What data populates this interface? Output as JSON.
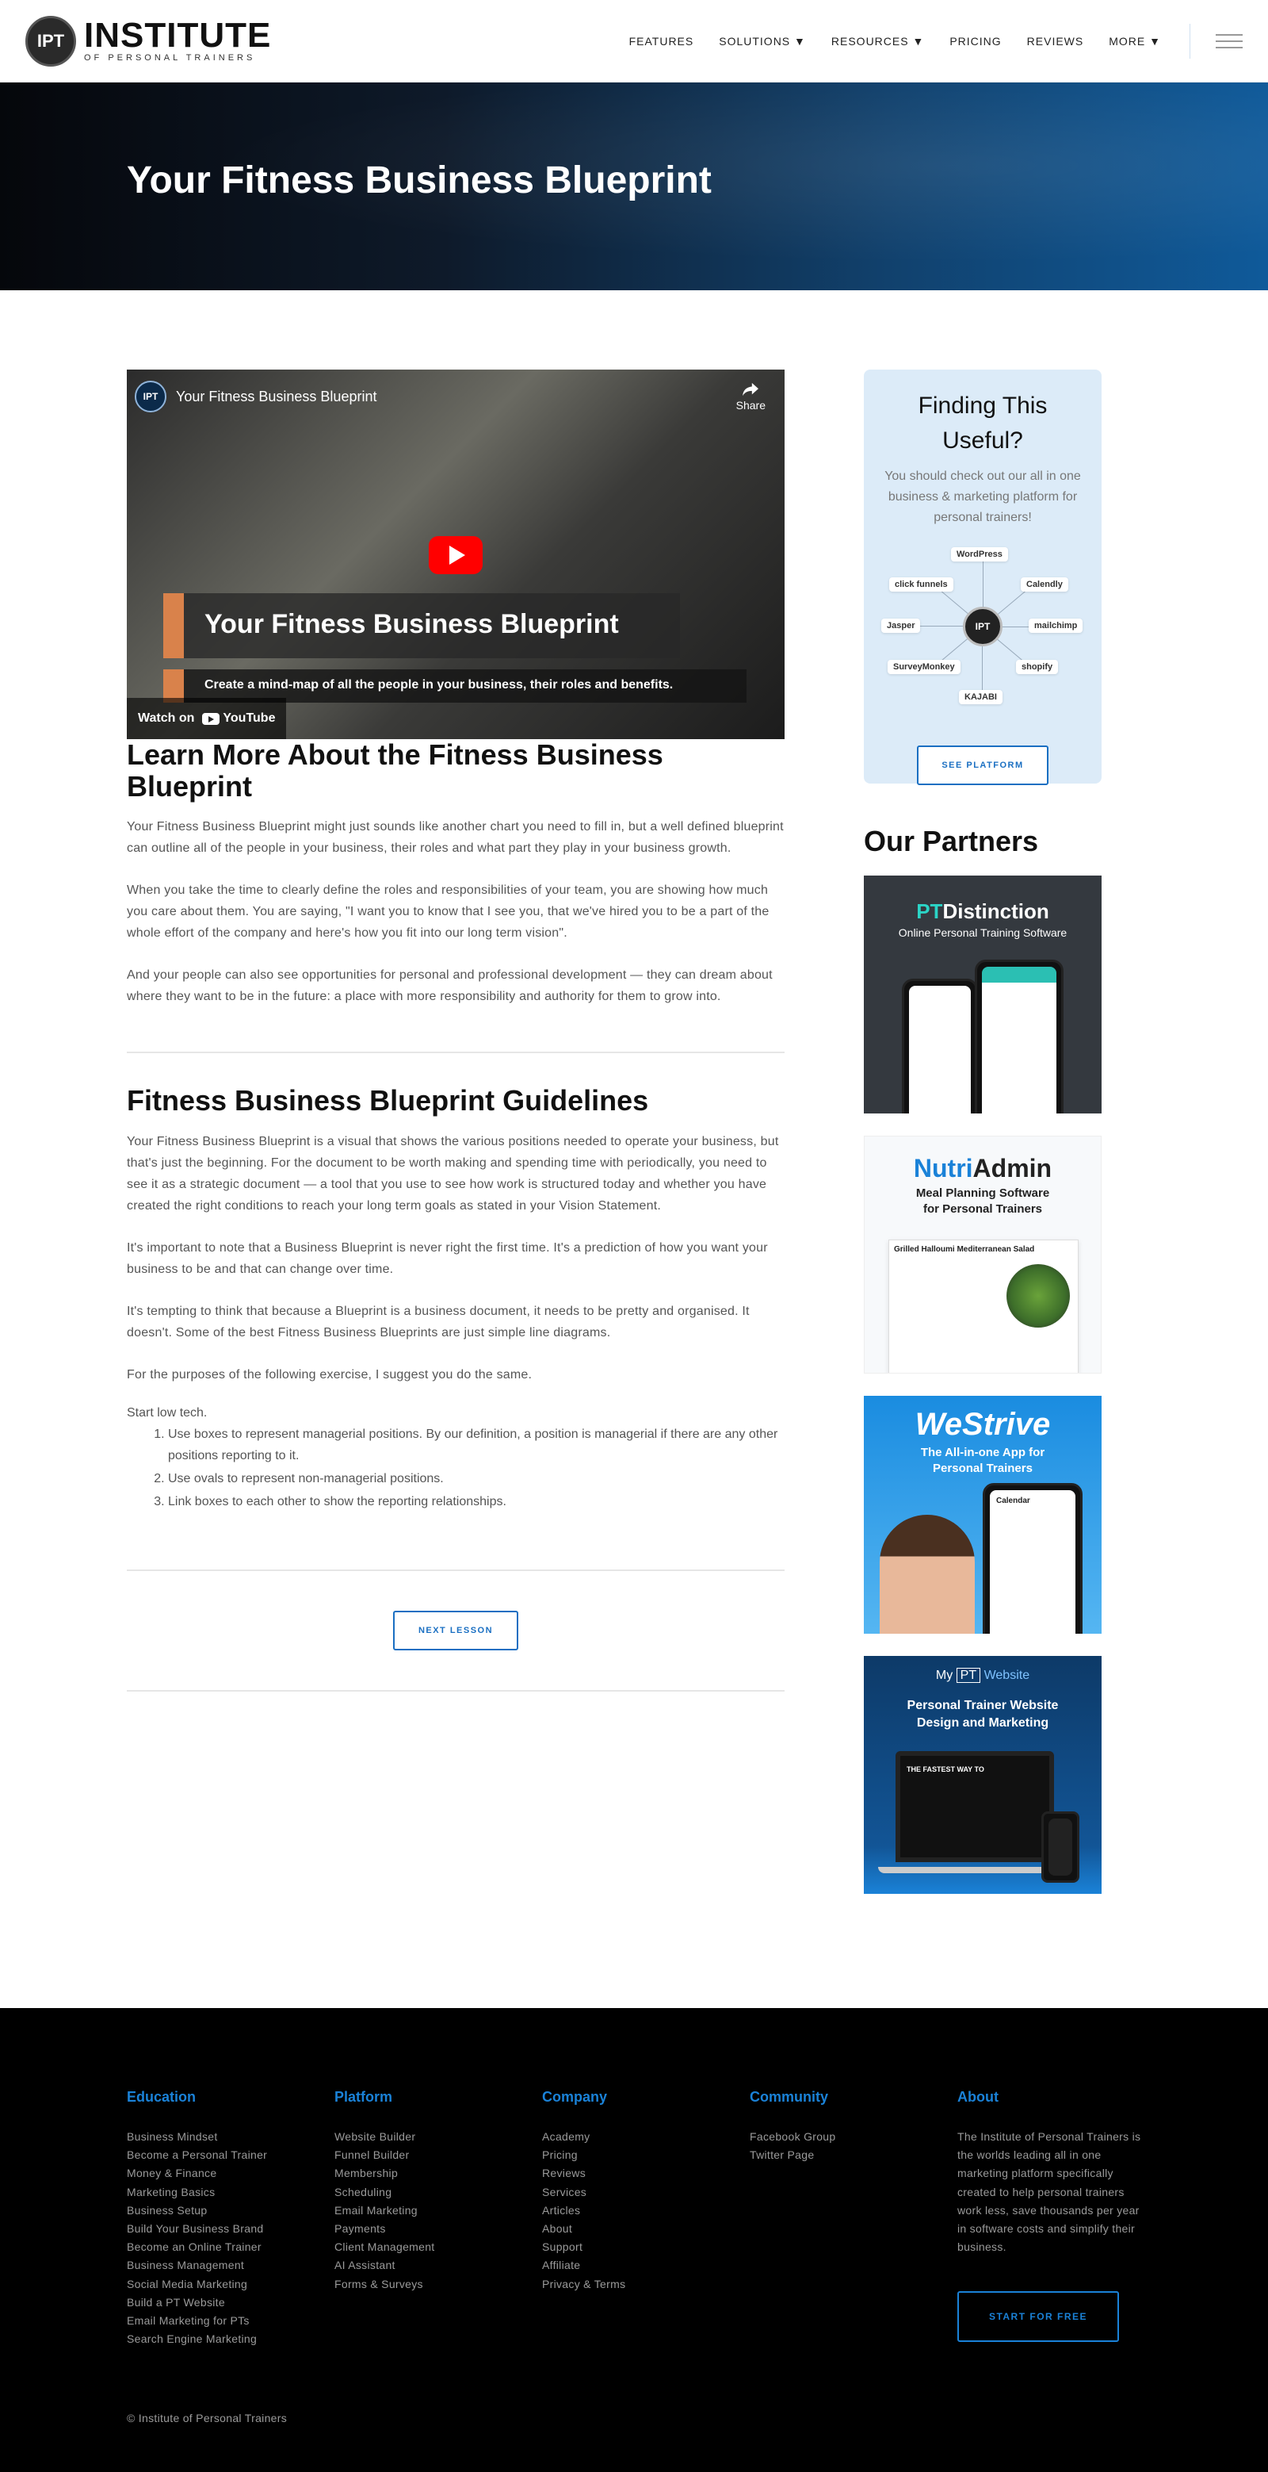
{
  "header": {
    "logo_badge": "IPT",
    "logo_main": "INSTITUTE",
    "logo_sub": "OF PERSONAL TRAINERS",
    "nav": [
      "FEATURES",
      "SOLUTIONS ▼",
      "RESOURCES ▼",
      "PRICING",
      "REVIEWS",
      "MORE ▼"
    ]
  },
  "hero": {
    "title": "Your Fitness Business Blueprint"
  },
  "video": {
    "channel_title": "Your Fitness Business Blueprint",
    "share_label": "Share",
    "overlay_title": "Your Fitness Business Blueprint",
    "overlay_subtitle": "Create a mind-map of all the people in your business, their roles and benefits.",
    "watch_on": "Watch on",
    "youtube": "YouTube"
  },
  "article": {
    "section1_title": "Learn More About the Fitness Business Blueprint",
    "section1_paras": [
      "Your Fitness Business Blueprint might just sounds like another chart you need to fill in, but a well defined blueprint can outline all of the people in your business, their roles and what part they play in your business growth.",
      "When you take the time to clearly define the roles and responsibilities of your team, you are showing how much you care about them. You are saying, \"I want you to know that I see you, that we've hired you to be a part of the whole effort of the company and here's how you fit into our long term vision\".",
      "And your people can also see opportunities for personal and professional development — they can dream about where they want to be in the future: a place with more responsibility and authority for them to grow into."
    ],
    "section2_title": "Fitness Business Blueprint Guidelines",
    "section2_paras": [
      "Your Fitness Business Blueprint is a visual that shows the various positions needed to operate your business, but that's just the beginning. For the document to be worth making and spending time with periodically, you need to see it as a strategic document — a tool that you use to see how work is structured today and whether you have created the right conditions to reach your long term goals as stated in your Vision Statement.",
      "It's important to note that a Business Blueprint is never right the first time. It's a prediction of how you want your business to be and that can change over time.",
      "It's tempting to think that because a Blueprint is a business document, it needs to be pretty and organised. It doesn't. Some of the best Fitness Business Blueprints are just simple line diagrams.",
      "For the purposes of the following exercise, I suggest you do the same."
    ],
    "start_text": "Start low tech.",
    "steps": [
      "Use boxes to represent managerial positions. By our definition, a position is managerial if there are any other positions reporting to it.",
      "Use ovals to represent non-managerial positions.",
      "Link boxes to each other to show the reporting relationships."
    ],
    "next_button": "NEXT LESSON"
  },
  "sidebar": {
    "promo_title": "Finding This Useful?",
    "promo_text": "You should check out our all in one business & marketing platform for personal trainers!",
    "tools": [
      "WordPress",
      "Calendly",
      "mailchimp",
      "shopify",
      "KAJABI",
      "SurveyMonkey",
      "Jasper",
      "click funnels"
    ],
    "hub_label": "IPT",
    "promo_button": "SEE PLATFORM",
    "partners_title": "Our Partners",
    "partners": [
      {
        "name_a": "PT",
        "name_b": "Distinction",
        "tagline": "Online Personal Training Software"
      },
      {
        "name_a": "Nutri",
        "name_b": "Admin",
        "tagline": "Meal Planning Software for Personal Trainers",
        "card_title": "Grilled Halloumi Mediterranean Salad"
      },
      {
        "name": "WeStrive",
        "tagline": "The All-in-one App for Personal Trainers",
        "app_label": "Calendar"
      },
      {
        "name_a": "My",
        "name_b": "PT",
        "name_c": "Website",
        "tagline": "Personal Trainer Website Design and Marketing",
        "screen_text": "THE FASTEST WAY TO"
      }
    ]
  },
  "footer": {
    "columns": [
      {
        "heading": "Education",
        "links": [
          "Business Mindset",
          "Become a Personal Trainer",
          "Money & Finance",
          "Marketing Basics",
          "Business Setup",
          "Build Your Business Brand",
          "Become an Online Trainer",
          "Business Management",
          "Social Media Marketing",
          "Build a PT Website",
          "Email Marketing for PTs",
          "Search Engine Marketing"
        ]
      },
      {
        "heading": "Platform",
        "links": [
          "Website Builder",
          "Funnel Builder",
          "Membership",
          "Scheduling",
          "Email Marketing",
          "Payments",
          "Client Management",
          "AI Assistant",
          "Forms & Surveys"
        ]
      },
      {
        "heading": "Company",
        "links": [
          "Academy",
          "Pricing",
          "Reviews",
          "Services",
          "Articles",
          "About",
          "Support",
          "Affiliate",
          "Privacy & Terms"
        ]
      },
      {
        "heading": "Community",
        "links": [
          "Facebook Group",
          "Twitter Page"
        ]
      }
    ],
    "about_heading": "About",
    "about_text": "The Institute of Personal Trainers is the worlds leading all in one marketing platform specifically created to help personal trainers work less, save thousands per year in software costs and simplify their business.",
    "cta": "START FOR FREE",
    "copyright": "© Institute of Personal Trainers"
  },
  "colors": {
    "accent": "#1a82d8",
    "footer_bg": "#000000",
    "promo_bg": "#dcebf8"
  }
}
